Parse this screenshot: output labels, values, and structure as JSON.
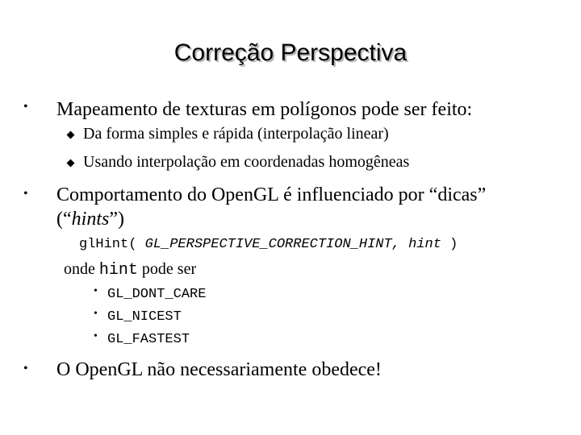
{
  "slide": {
    "title": "Correção Perspectiva",
    "bullets": [
      {
        "text": "Mapeamento de texturas em polígonos pode ser feito:",
        "sub_bullets": [
          "Da forma simples e rápida (interpolação linear)",
          "Usando interpolação em coordenadas homogêneas"
        ]
      },
      {
        "text_line1": "Comportamento do OpenGL é influenciado por “dicas”",
        "text_line2_open": "(“",
        "text_line2_italic": "hints",
        "text_line2_close": "”)",
        "code": {
          "function": "glHint(",
          "arg1": "GL_PERSPECTIVE_CORRECTION_HINT,",
          "arg2": "hint",
          "close": ")"
        },
        "where_prefix": "onde",
        "where_var": "hint",
        "where_suffix": "pode ser",
        "options": [
          "GL_DONT_CARE",
          "GL_NICEST",
          "GL_FASTEST"
        ]
      },
      {
        "text": "O OpenGL não necessariamente obedece!"
      }
    ],
    "bullet_glyph": "•"
  }
}
